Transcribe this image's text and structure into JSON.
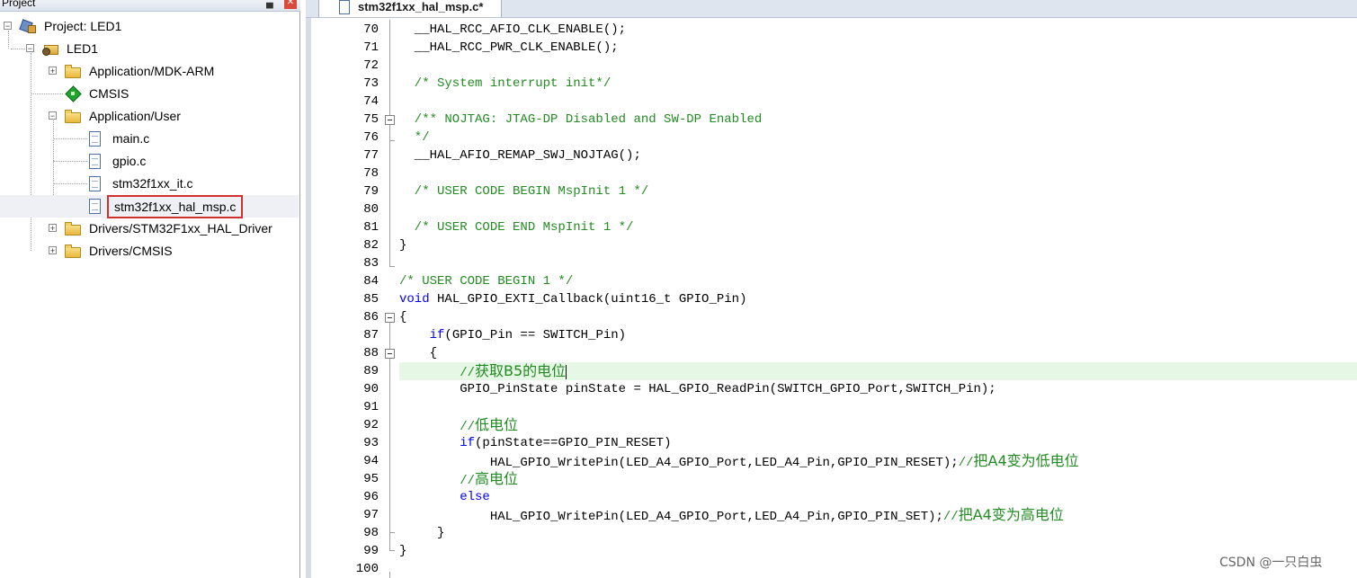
{
  "project_panel": {
    "title": "Project",
    "pin_glyph": "▄",
    "close_glyph": "✕",
    "tree": [
      {
        "label": "Project: LED1",
        "icon": "project-icon"
      },
      {
        "label": "LED1",
        "icon": "target-icon"
      },
      {
        "label": "Application/MDK-ARM",
        "icon": "folder-icon"
      },
      {
        "label": "CMSIS",
        "icon": "diamond-icon"
      },
      {
        "label": "Application/User",
        "icon": "folder-icon"
      },
      {
        "label": "main.c",
        "icon": "file-icon"
      },
      {
        "label": "gpio.c",
        "icon": "file-icon"
      },
      {
        "label": "stm32f1xx_it.c",
        "icon": "file-icon"
      },
      {
        "label": "stm32f1xx_hal_msp.c",
        "icon": "file-icon",
        "selected": true
      },
      {
        "label": "Drivers/STM32F1xx_HAL_Driver",
        "icon": "folder-icon"
      },
      {
        "label": "Drivers/CMSIS",
        "icon": "folder-icon"
      }
    ],
    "expander_plus": "+",
    "expander_minus": "−"
  },
  "editor": {
    "active_tab": "stm32f1xx_hal_msp.c*",
    "lines": [
      {
        "num": "70",
        "text": "  __HAL_RCC_AFIO_CLK_ENABLE();"
      },
      {
        "num": "71",
        "text": "  __HAL_RCC_PWR_CLK_ENABLE();"
      },
      {
        "num": "72",
        "text": ""
      },
      {
        "num": "73",
        "text": "  /* System interrupt init*/"
      },
      {
        "num": "74",
        "text": ""
      },
      {
        "num": "75",
        "text": "  /** NOJTAG: JTAG-DP Disabled and SW-DP Enabled"
      },
      {
        "num": "76",
        "text": "  */"
      },
      {
        "num": "77",
        "text": "  __HAL_AFIO_REMAP_SWJ_NOJTAG();"
      },
      {
        "num": "78",
        "text": ""
      },
      {
        "num": "79",
        "text": "  /* USER CODE BEGIN MspInit 1 */"
      },
      {
        "num": "80",
        "text": ""
      },
      {
        "num": "81",
        "text": "  /* USER CODE END MspInit 1 */"
      },
      {
        "num": "82",
        "text": "}"
      },
      {
        "num": "83",
        "text": ""
      },
      {
        "num": "84",
        "text": "/* USER CODE BEGIN 1 */"
      },
      {
        "num": "85",
        "kw": "void",
        "text": " HAL_GPIO_EXTI_Callback(uint16_t GPIO_Pin)"
      },
      {
        "num": "86",
        "text": "{"
      },
      {
        "num": "87",
        "indent": "    ",
        "kw": "if",
        "text": "(GPIO_Pin == SWITCH_Pin)"
      },
      {
        "num": "88",
        "text": "    {"
      },
      {
        "num": "89",
        "comment_prefix": "        //",
        "cjk": "获取B5的电位"
      },
      {
        "num": "90",
        "text": "        GPIO_PinState pinState = HAL_GPIO_ReadPin(SWITCH_GPIO_Port,SWITCH_Pin);"
      },
      {
        "num": "91",
        "text": ""
      },
      {
        "num": "92",
        "comment_prefix": "        //",
        "cjk": "低电位"
      },
      {
        "num": "93",
        "indent": "        ",
        "kw": "if",
        "text": "(pinState==GPIO_PIN_RESET)"
      },
      {
        "num": "94",
        "text": "            HAL_GPIO_WritePin(LED_A4_GPIO_Port,LED_A4_Pin,GPIO_PIN_RESET);",
        "comment_prefix": "//",
        "cjk": "把A4变为低电位"
      },
      {
        "num": "95",
        "comment_prefix": "        //",
        "cjk": "高电位"
      },
      {
        "num": "96",
        "indent": "        ",
        "kw": "else",
        "text": ""
      },
      {
        "num": "97",
        "text": "            HAL_GPIO_WritePin(LED_A4_GPIO_Port,LED_A4_Pin,GPIO_PIN_SET);",
        "comment_prefix": "//",
        "cjk": "把A4变为高电位"
      },
      {
        "num": "98",
        "text": "     }"
      },
      {
        "num": "99",
        "text": "}"
      },
      {
        "num": "100",
        "text": ""
      }
    ]
  },
  "watermark": "CSDN @一只白虫",
  "colors": {
    "comment": "#228b22",
    "keyword": "#0000ff",
    "current_line": "#e6f7e6",
    "selection_box": "#d0312d"
  }
}
